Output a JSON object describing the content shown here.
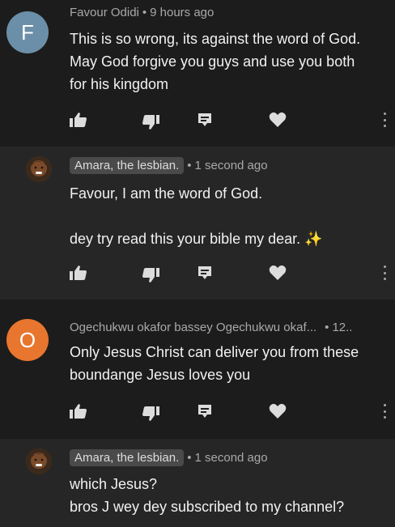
{
  "comments": [
    {
      "avatar_letter": "F",
      "avatar_color": "#6b8fa8",
      "author": "Favour Odidi",
      "time": "9 hours ago",
      "lines": [
        "This is so wrong, its against the word of God.",
        "May God forgive you guys and use you both",
        "for his kingdom"
      ]
    },
    {
      "author": "Amara, the lesbian.",
      "time": "1 second ago",
      "lines": [
        "Favour, I am the word of God.",
        "",
        "dey try read this your bible my dear. ✨"
      ]
    },
    {
      "avatar_letter": "O",
      "avatar_color": "#e8762f",
      "author": "Ogechukwu okafor bassey Ogechukwu okaf...",
      "time": "12..",
      "lines": [
        "Only Jesus Christ can deliver you from these",
        "boundange Jesus loves you"
      ]
    },
    {
      "author": "Amara, the lesbian.",
      "time": "1 second ago",
      "lines": [
        "which Jesus?",
        "bros J wey dey subscribed to my channel?"
      ]
    }
  ],
  "separator": "•",
  "icons": {
    "like": "thumbs-up-icon",
    "dislike": "thumbs-down-icon",
    "reply": "reply-icon",
    "heart": "heart-icon",
    "more": "more-vertical-icon"
  }
}
